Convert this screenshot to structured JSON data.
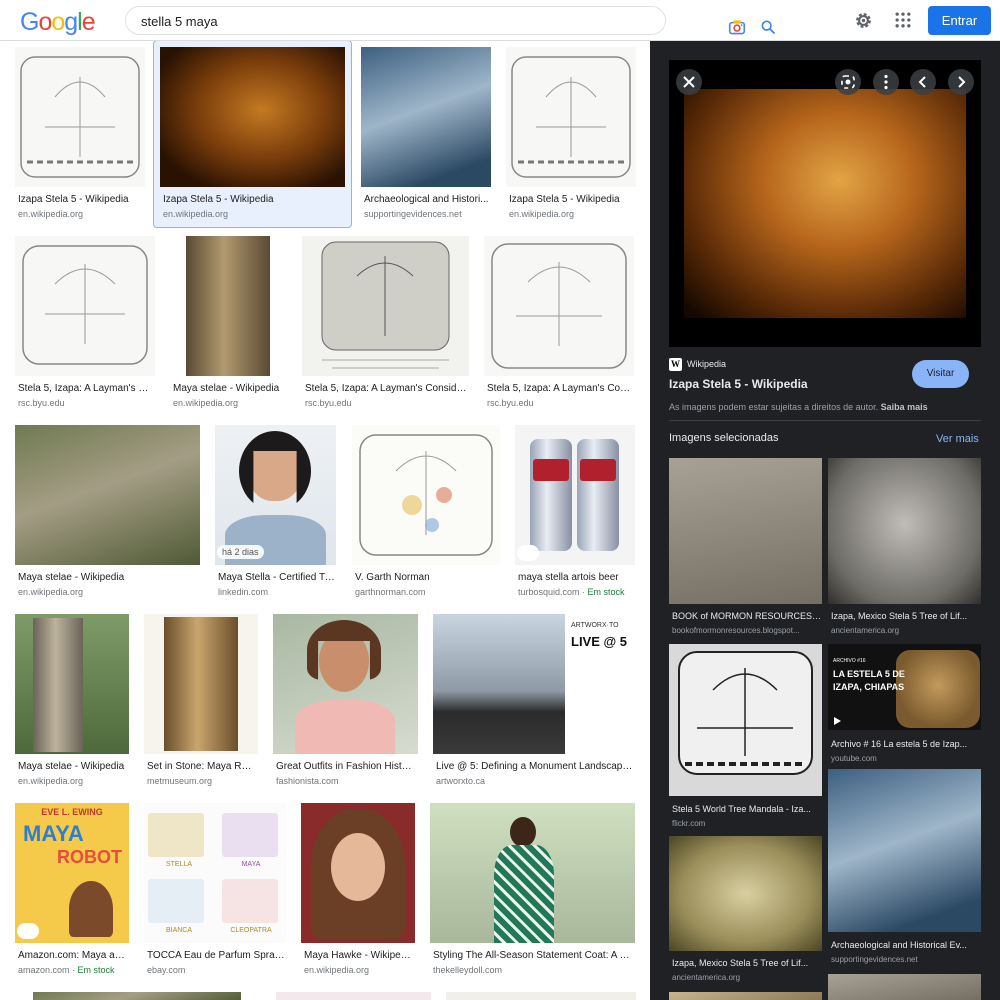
{
  "header": {
    "logo_letters": [
      "G",
      "o",
      "o",
      "g",
      "l",
      "e"
    ],
    "logo_colors": [
      "#4285F4",
      "#EA4335",
      "#FBBC05",
      "#4285F4",
      "#34A853",
      "#EA4335"
    ],
    "search_value": "stella 5 maya",
    "signin_label": "Entrar"
  },
  "results": [
    {
      "title": "Izapa Stela 5 - Wikipedia",
      "source": "en.wikipedia.org"
    },
    {
      "title": "Izapa Stela 5 - Wikipedia",
      "source": "en.wikipedia.org"
    },
    {
      "title": "Archaeological and Histori...",
      "source": "supportingevidences.net"
    },
    {
      "title": "Izapa Stela 5 - Wikipedia",
      "source": "en.wikipedia.org"
    },
    {
      "title": "Stela 5, Izapa: A Layman's Co...",
      "source": "rsc.byu.edu"
    },
    {
      "title": "Maya stelae - Wikipedia",
      "source": "en.wikipedia.org"
    },
    {
      "title": "Stela 5, Izapa: A Layman's Consider...",
      "source": "rsc.byu.edu"
    },
    {
      "title": "Stela 5, Izapa: A Layman's Cons...",
      "source": "rsc.byu.edu"
    },
    {
      "title": "Maya stelae - Wikipedia",
      "source": "en.wikipedia.org"
    },
    {
      "title": "Maya Stella - Certified Tr...",
      "source": "linkedin.com",
      "badge": "há 2 dias"
    },
    {
      "title": "V. Garth Norman",
      "source": "garthnorman.com"
    },
    {
      "title": "maya stella artois beer",
      "source": "turbosquid.com",
      "stock": "Em stock"
    },
    {
      "title": "Maya stelae - Wikipedia",
      "source": "en.wikipedia.org"
    },
    {
      "title": "Set in Stone: Maya Rul...",
      "source": "metmuseum.org"
    },
    {
      "title": "Great Outfits in Fashion Histor...",
      "source": "fashionista.com"
    },
    {
      "title": "Live @ 5: Defining a Monument Landscape ...",
      "source": "artworxto.ca"
    },
    {
      "title": "Amazon.com: Maya an...",
      "source": "amazon.com",
      "stock": "Em stock"
    },
    {
      "title": "TOCCA Eau de Parfum Spray ...",
      "source": "ebay.com"
    },
    {
      "title": "Maya Hawke - Wikipedia",
      "source": "en.wikipedia.org"
    },
    {
      "title": "Styling The All-Season Statement Coat: A Co...",
      "source": "thekelleydoll.com"
    }
  ],
  "panel": {
    "site_name": "Wikipedia",
    "site_letter": "W",
    "title": "Izapa Stela 5 - Wikipedia",
    "visit_label": "Visitar",
    "copyright_text": "As imagens podem estar sujeitas a direitos de autor.",
    "learn_more": "Saiba mais",
    "related_heading": "Imagens selecionadas",
    "see_more": "Ver mais",
    "related": [
      {
        "title": "BOOK of MORMON RESOURCES:...",
        "source": "bookofmormonresources.blogspot..."
      },
      {
        "title": "Izapa, Mexico Stela 5 Tree of Lif...",
        "source": "ancientamerica.org"
      },
      {
        "title": "Stela 5 World Tree Mandala - Iza...",
        "source": "flickr.com"
      },
      {
        "title": "Archivo # 16 La estela 5 de Izap...",
        "source": "youtube.com"
      },
      {
        "title": "Izapa, Mexico Stela 5 Tree of Lif...",
        "source": "ancientamerica.org"
      },
      {
        "title": "Archaeological and Historical Ev...",
        "source": "supportingevidences.net"
      }
    ],
    "video_text_1": "ARCHIVO #16",
    "video_text_2": "LA ESTELA 5 DE",
    "video_text_3": "IZAPA, CHIAPAS"
  },
  "thumb_text": {
    "artworx_brand": "ARTWORX·TO",
    "artworx_headline": "LIVE @ 5",
    "book_author": "EVE L. EWING",
    "book_title_1": "MAYA",
    "book_title_2": "ROBOT",
    "perfume_1": "STELLA",
    "perfume_2": "MAYA",
    "perfume_3": "BIANCA",
    "perfume_4": "CLEOPATRA"
  }
}
